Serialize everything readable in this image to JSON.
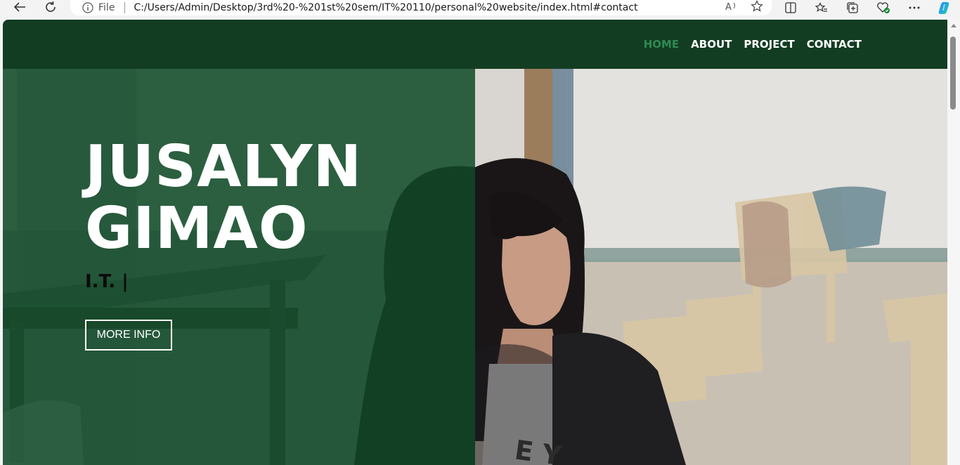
{
  "browser": {
    "address_label": "File",
    "url": "C:/Users/Admin/Desktop/3rd%20-%201st%20sem/IT%20110/personal%20website/index.html#contact"
  },
  "nav": {
    "items": [
      {
        "label": "HOME",
        "active": true
      },
      {
        "label": "ABOUT",
        "active": false
      },
      {
        "label": "PROJECT",
        "active": false
      },
      {
        "label": "CONTACT",
        "active": false
      }
    ]
  },
  "hero": {
    "title_line1": "JUSALYN",
    "title_line2": "GIMAO",
    "subtitle": "I.T. |",
    "button_label": "MORE INFO"
  },
  "colors": {
    "header_bg": "#133d22",
    "nav_active": "#2e8a52",
    "overlay": "#124828"
  },
  "icons": [
    "back-arrow-icon",
    "refresh-icon",
    "info-icon",
    "read-aloud-icon",
    "favorite-star-icon",
    "split-screen-icon",
    "favorites-icon",
    "collections-icon",
    "browser-essentials-icon",
    "more-options-icon",
    "copilot-icon"
  ]
}
